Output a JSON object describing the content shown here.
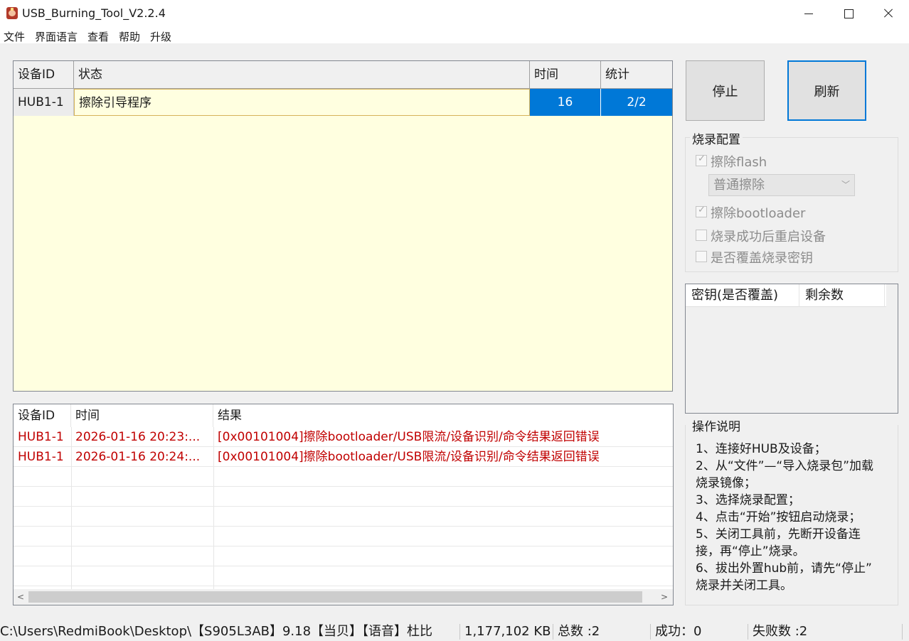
{
  "window": {
    "title": "USB_Burning_Tool_V2.2.4"
  },
  "menu": [
    "文件",
    "界面语言",
    "查看",
    "帮助",
    "升级"
  ],
  "device_table": {
    "headers": [
      "设备ID",
      "状态",
      "时间",
      "统计"
    ],
    "rows": [
      {
        "id": "HUB1-1",
        "status": "擦除引导程序",
        "time": "16",
        "stats": "2/2"
      }
    ]
  },
  "buttons": {
    "stop": "停止",
    "refresh": "刷新"
  },
  "burn_config": {
    "title": "烧录配置",
    "erase_flash": "擦除flash",
    "erase_mode": "普通擦除",
    "erase_bootloader": "擦除bootloader",
    "reboot_after": "烧录成功后重启设备",
    "overwrite_key": "是否覆盖烧录密钥"
  },
  "key_table": {
    "headers": [
      "密钥(是否覆盖)",
      "剩余数"
    ]
  },
  "instructions": {
    "title": "操作说明",
    "lines": [
      "1、连接好HUB及设备；",
      "2、从“文件”—“导入烧录包”加载",
      "烧录镜像；",
      "3、选择烧录配置；",
      "4、点击“开始”按钮启动烧录；",
      "5、关闭工具前，先断开设备连",
      "接，再“停止”烧录。",
      "6、拔出外置hub前，请先“停止”",
      "烧录并关闭工具。"
    ]
  },
  "log_table": {
    "headers": [
      "设备ID",
      "时间",
      "结果"
    ],
    "rows": [
      {
        "id": "HUB1-1",
        "time": "2026-01-16 20:23:...",
        "result": "[0x00101004]擦除bootloader/USB限流/设备识别/命令结果返回错误"
      },
      {
        "id": "HUB1-1",
        "time": "2026-01-16 20:24:...",
        "result": "[0x00101004]擦除bootloader/USB限流/设备识别/命令结果返回错误"
      }
    ]
  },
  "statusbar": {
    "path": "C:\\Users\\RedmiBook\\Desktop\\【S905L3AB】9.18【当贝】【语音】杜比",
    "size": "1,177,102 KB",
    "total": "总数 :2",
    "success": "成功：0",
    "fail": "失败数 :2"
  },
  "colors": {
    "selection": "#0078d7",
    "error_text": "#c00000",
    "table_bg": "#ffffe0"
  }
}
